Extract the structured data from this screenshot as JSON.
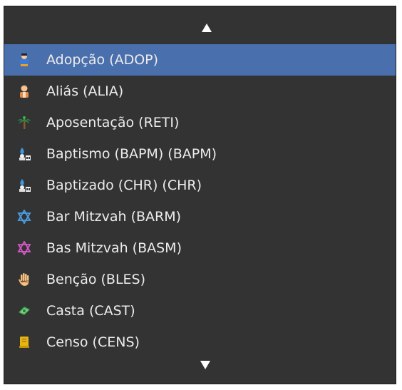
{
  "menu": {
    "items": [
      {
        "label": "Adopção (ADOP)",
        "icon": "adoption-person-icon",
        "selected": true
      },
      {
        "label": "Aliás (ALIA)",
        "icon": "alias-person-icon"
      },
      {
        "label": "Aposentação (RETI)",
        "icon": "palm-tree-icon"
      },
      {
        "label": "Baptismo (BAPM) (BAPM)",
        "icon": "baptism-water-icon"
      },
      {
        "label": "Baptizado (CHR) (CHR)",
        "icon": "christening-water-icon"
      },
      {
        "label": "Bar Mitzvah (BARM)",
        "icon": "star-of-david-blue-icon"
      },
      {
        "label": "Bas Mitzvah (BASM)",
        "icon": "star-of-david-pink-icon"
      },
      {
        "label": "Benção (BLES)",
        "icon": "blessing-hand-icon"
      },
      {
        "label": "Casta (CAST)",
        "icon": "caste-money-icon"
      },
      {
        "label": "Censo (CENS)",
        "icon": "census-document-icon"
      }
    ]
  },
  "colors": {
    "background": "#333333",
    "selected": "#4a6fad",
    "text": "#ececec"
  }
}
